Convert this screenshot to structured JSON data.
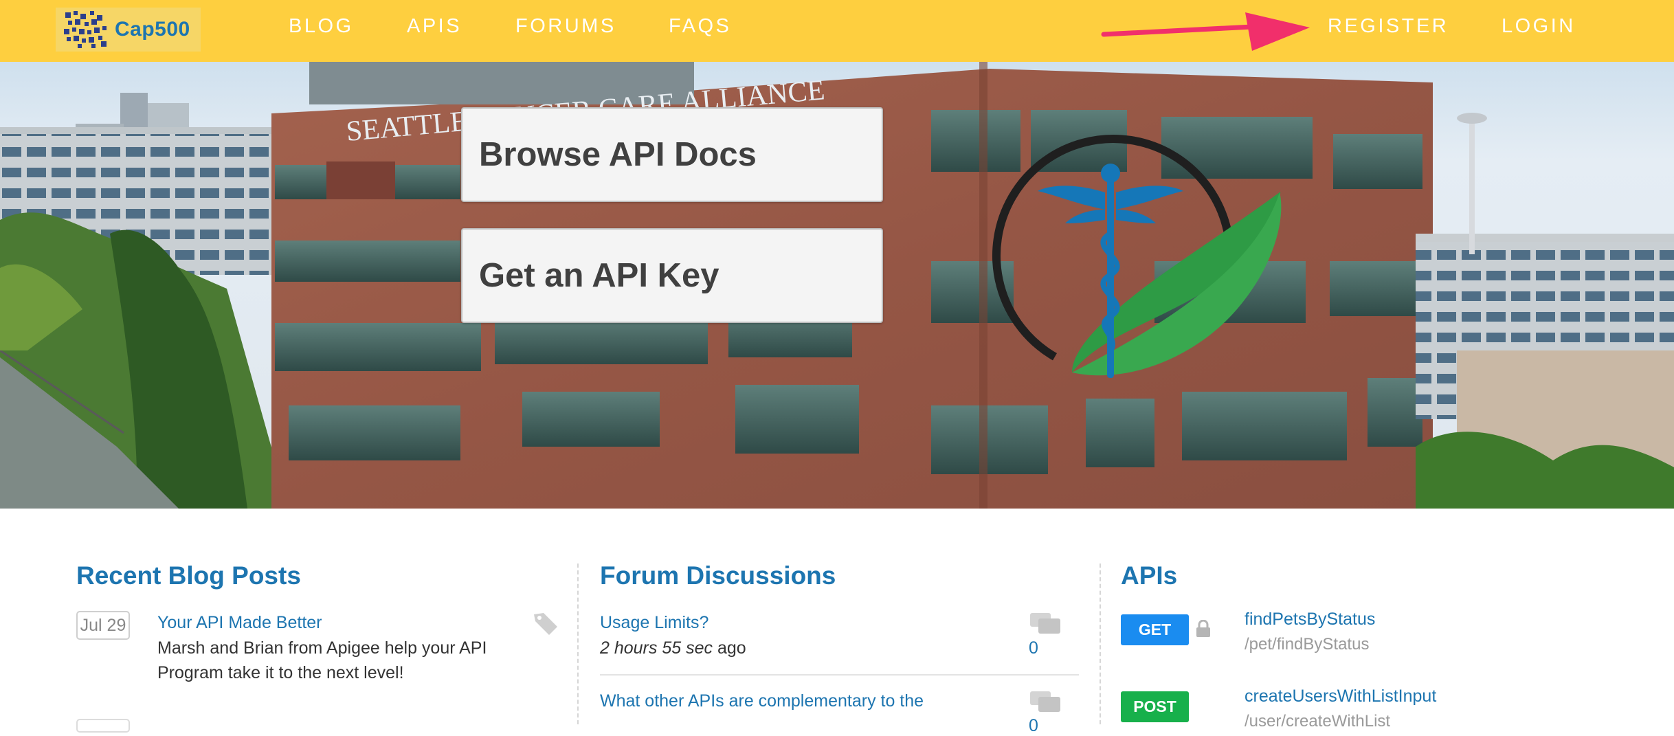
{
  "brand": {
    "name": "Cap500"
  },
  "nav": {
    "left": [
      {
        "label": "BLOG"
      },
      {
        "label": "APIS"
      },
      {
        "label": "FORUMS"
      },
      {
        "label": "FAQS"
      }
    ],
    "right": [
      {
        "label": "REGISTER"
      },
      {
        "label": "LOGIN"
      }
    ]
  },
  "hero": {
    "building_sign": "SEATTLE CANCER CARE ALLIANCE",
    "buttons": [
      {
        "label": "Browse API Docs"
      },
      {
        "label": "Get an API Key"
      }
    ]
  },
  "blog": {
    "title": "Recent Blog Posts",
    "posts": [
      {
        "date": "Jul 29",
        "title": "Your API Made Better",
        "excerpt_line1": "Marsh and Brian from Apigee help your API",
        "excerpt_line2": "Program take it to the next level!"
      }
    ]
  },
  "forum": {
    "title": "Forum Discussions",
    "topics": [
      {
        "title": "Usage Limits?",
        "time": "2 hours 55 sec",
        "suffix": "ago",
        "count": "0"
      },
      {
        "title": "What other APIs are complementary to the",
        "count": "0"
      }
    ]
  },
  "apis": {
    "title": "APIs",
    "items": [
      {
        "method": "GET",
        "name": "findPetsByStatus",
        "path": "/pet/findByStatus",
        "color": "#1a8cf0",
        "locked": true
      },
      {
        "method": "POST",
        "name": "createUsersWithListInput",
        "path": "/user/createWithList",
        "color": "#17b04b",
        "locked": false
      }
    ]
  },
  "colors": {
    "navbar": "#fecf3f",
    "link": "#1d75b0",
    "arrow": "#f12f6b"
  }
}
